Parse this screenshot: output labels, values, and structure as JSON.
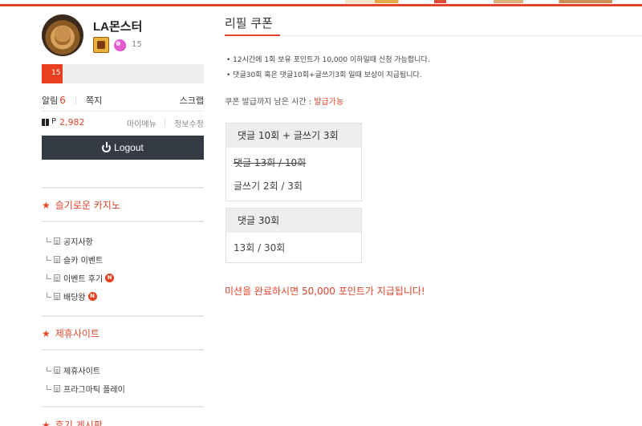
{
  "profile": {
    "username": "LA몬스터",
    "level": "15",
    "exp_text": "15",
    "exp_percent": 13
  },
  "account": {
    "alarm_label": "알림",
    "alarm_count": "6",
    "note_label": "쪽지",
    "scrap_label": "스크랩",
    "point_prefix": "P",
    "point_value": "2,982",
    "mymenu_label": "마이메뉴",
    "edit_label": "정보수정",
    "logout_label": "Logout"
  },
  "sections": [
    {
      "title": "슬기로운 카지노",
      "items": [
        {
          "label": "공지사항",
          "new": ""
        },
        {
          "label": "슬카 이벤트",
          "new": ""
        },
        {
          "label": "이벤트 후기",
          "new": "N"
        },
        {
          "label": "배당왕",
          "new": "N"
        }
      ]
    },
    {
      "title": "제휴사이트",
      "items": [
        {
          "label": "제휴사이트",
          "new": ""
        },
        {
          "label": "프라그마틱 플레이",
          "new": ""
        }
      ]
    },
    {
      "title": "후기 게시판",
      "items": []
    }
  ],
  "main": {
    "tab_title": "리필 쿠폰",
    "notices": [
      "• 12시간에 1회 보유 포인트가 10,000 이하일때 신청 가능합니다.",
      "• 댓글30회 혹은 댓글10회+글쓰기3회 일때 보상이 지급됩니다."
    ],
    "timer_label": "쿠폰 발급까지 남은 시간 :",
    "timer_value": "발급가능",
    "box1": {
      "title": "댓글 10회 + 글쓰기 3회",
      "line1": "댓글 13회 / 10회",
      "line2": "글쓰기 2회 / 3회"
    },
    "box2": {
      "title": "댓글 30회",
      "line1": "13회 / 30회"
    },
    "final_message": "미션을 완료하시면 50,000 포인트가 지급됩니다!"
  },
  "colors": {
    "accent": "#e0452c",
    "logout_bg": "#353b45"
  }
}
